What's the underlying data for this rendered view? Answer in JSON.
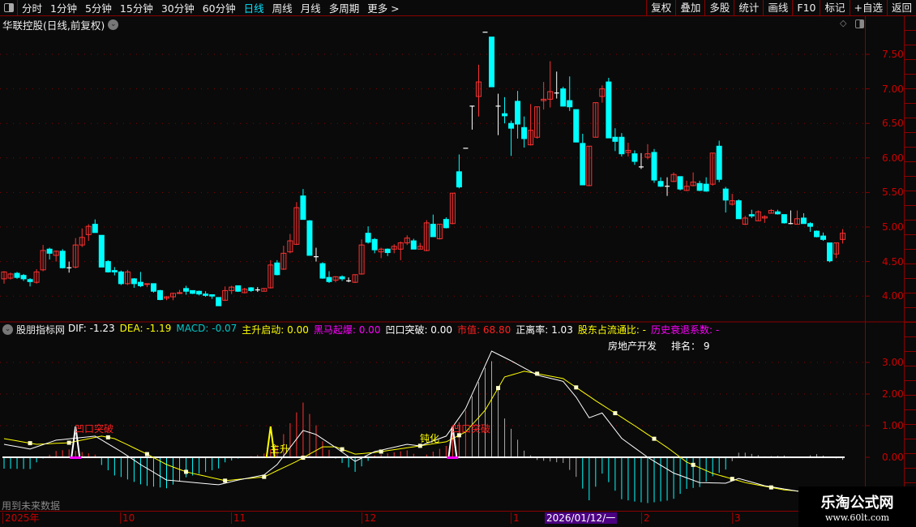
{
  "topbar": {
    "tabs": [
      "分时",
      "1分钟",
      "5分钟",
      "15分钟",
      "30分钟",
      "60分钟",
      "日线",
      "周线",
      "月线",
      "多周期",
      "更多 >"
    ],
    "active": "日线",
    "buttons": [
      "复权",
      "叠加",
      "多股",
      "统计",
      "画线",
      "F10",
      "标记",
      "+自选",
      "返回"
    ]
  },
  "title": "华联控股(日线,前复权)",
  "price_axis": [
    "7.50",
    "7.00",
    "6.50",
    "6.00",
    "5.50",
    "5.00",
    "4.50",
    "4.00"
  ],
  "ind_axis": [
    "3.00",
    "2.00",
    "1.00",
    "0.00"
  ],
  "indicator": {
    "name": "股朋指标网",
    "items": [
      {
        "label": "DIF: -1.23",
        "color": "#ffffff"
      },
      {
        "label": "DEA: -1.19",
        "color": "#ffff00"
      },
      {
        "label": "MACD: -0.07",
        "color": "#00c8c8"
      },
      {
        "label": "主升启动: 0.00",
        "color": "#ffff00"
      },
      {
        "label": "黑马起爆: 0.00",
        "color": "#ff00ff"
      },
      {
        "label": "凹口突破: 0.00",
        "color": "#ffffff"
      },
      {
        "label": "市值: 68.80",
        "color": "#ff2020"
      },
      {
        "label": "正离率: 1.03",
        "color": "#ffffff"
      },
      {
        "label": "股东占流通比: -",
        "color": "#ffff00"
      },
      {
        "label": "历史衰退系数: -",
        "color": "#ff00ff"
      }
    ],
    "sector": "房地产开发",
    "rank": "排名： 9"
  },
  "signals": {
    "breakout": "凹口突破",
    "main_rise": "主升",
    "dull": "钝化"
  },
  "future_note": "用到未来数据",
  "date_axis": {
    "labels": [
      "2025年",
      "10",
      "11",
      "12",
      "1",
      "2",
      "3"
    ],
    "current": "2026/01/12/一"
  },
  "watermark": {
    "name": "乐淘公式网",
    "url": "www.60lt.com"
  },
  "colors": {
    "up": "#ff3232",
    "down": "#00ffff",
    "doji": "#ffffff",
    "grid": "#8b0000"
  },
  "chart_data": {
    "type": "candlestick",
    "ylim": [
      3.7,
      7.9
    ],
    "ohlc": [
      [
        4.25,
        4.36,
        4.18,
        4.35
      ],
      [
        4.26,
        4.34,
        4.24,
        4.32
      ],
      [
        4.33,
        4.35,
        4.25,
        4.27
      ],
      [
        4.3,
        4.32,
        4.22,
        4.25
      ],
      [
        4.24,
        4.26,
        4.14,
        4.21
      ],
      [
        4.2,
        4.39,
        4.18,
        4.35
      ],
      [
        4.38,
        4.74,
        4.36,
        4.66
      ],
      [
        4.68,
        4.7,
        4.53,
        4.62
      ],
      [
        4.59,
        4.66,
        4.5,
        4.65
      ],
      [
        4.65,
        4.68,
        4.4,
        4.41
      ],
      [
        4.41,
        4.5,
        4.34,
        4.41
      ],
      [
        4.42,
        4.84,
        4.4,
        4.74
      ],
      [
        4.74,
        4.98,
        4.71,
        4.85
      ],
      [
        4.89,
        5.04,
        4.8,
        5.01
      ],
      [
        5.04,
        5.11,
        4.92,
        4.92
      ],
      [
        4.88,
        4.88,
        4.42,
        4.42
      ],
      [
        4.5,
        4.52,
        4.34,
        4.35
      ],
      [
        4.37,
        4.42,
        4.3,
        4.35
      ],
      [
        4.35,
        4.37,
        4.16,
        4.18
      ],
      [
        4.18,
        4.38,
        4.16,
        4.35
      ],
      [
        4.25,
        4.26,
        4.12,
        4.18
      ],
      [
        4.2,
        4.35,
        4.13,
        4.15
      ],
      [
        4.17,
        4.18,
        4.13,
        4.18
      ],
      [
        4.18,
        4.18,
        4.05,
        4.07
      ],
      [
        4.08,
        4.09,
        3.94,
        3.95
      ],
      [
        3.97,
        4.0,
        3.94,
        3.99
      ],
      [
        3.99,
        4.05,
        3.94,
        4.04
      ],
      [
        4.04,
        4.09,
        4.03,
        4.05
      ],
      [
        4.11,
        4.15,
        4.02,
        4.07
      ],
      [
        4.08,
        4.08,
        4.03,
        4.04
      ],
      [
        4.07,
        4.08,
        4.01,
        4.03
      ],
      [
        4.03,
        4.07,
        3.99,
        4.01
      ],
      [
        4.02,
        4.02,
        3.96,
        4.0
      ],
      [
        3.98,
        3.98,
        3.86,
        3.86
      ],
      [
        3.94,
        4.14,
        3.93,
        4.08
      ],
      [
        4.08,
        4.15,
        4.03,
        4.13
      ],
      [
        4.15,
        4.15,
        4.06,
        4.07
      ],
      [
        4.05,
        4.12,
        4.04,
        4.1
      ],
      [
        4.12,
        4.13,
        4.06,
        4.08
      ],
      [
        4.09,
        4.13,
        4.06,
        4.09
      ],
      [
        4.07,
        4.11,
        4.07,
        4.11
      ],
      [
        4.12,
        4.52,
        4.11,
        4.45
      ],
      [
        4.48,
        4.52,
        4.3,
        4.31
      ],
      [
        4.39,
        4.73,
        4.38,
        4.62
      ],
      [
        4.64,
        4.9,
        4.62,
        4.8
      ],
      [
        4.75,
        5.36,
        4.74,
        5.28
      ],
      [
        5.45,
        5.55,
        5.11,
        5.11
      ],
      [
        5.09,
        5.1,
        4.59,
        4.59
      ],
      [
        4.57,
        4.7,
        4.5,
        4.57
      ],
      [
        4.47,
        4.49,
        4.25,
        4.26
      ],
      [
        4.27,
        4.36,
        4.19,
        4.21
      ],
      [
        4.23,
        4.29,
        4.2,
        4.28
      ],
      [
        4.28,
        4.3,
        4.22,
        4.25
      ],
      [
        4.22,
        4.27,
        4.2,
        4.22
      ],
      [
        4.2,
        4.31,
        4.19,
        4.31
      ],
      [
        4.32,
        4.82,
        4.31,
        4.74
      ],
      [
        4.91,
        5.01,
        4.76,
        4.78
      ],
      [
        4.82,
        4.84,
        4.62,
        4.67
      ],
      [
        4.64,
        4.7,
        4.55,
        4.68
      ],
      [
        4.68,
        4.69,
        4.58,
        4.63
      ],
      [
        4.68,
        4.75,
        4.62,
        4.72
      ],
      [
        4.68,
        4.79,
        4.52,
        4.77
      ],
      [
        4.77,
        4.88,
        4.74,
        4.84
      ],
      [
        4.8,
        4.83,
        4.68,
        4.68
      ],
      [
        4.68,
        4.77,
        4.68,
        4.72
      ],
      [
        4.66,
        5.1,
        4.65,
        5.06
      ],
      [
        5.04,
        5.18,
        4.86,
        4.86
      ],
      [
        4.83,
        5.04,
        4.82,
        5.04
      ],
      [
        5.11,
        5.14,
        4.98,
        4.99
      ],
      [
        5.05,
        5.49,
        5.04,
        5.49
      ],
      [
        5.8,
        6.05,
        5.56,
        5.58
      ],
      [
        6.14,
        6.14,
        6.14,
        6.14
      ],
      [
        6.75,
        6.75,
        6.41,
        6.75
      ],
      [
        6.89,
        7.35,
        6.6,
        7.1
      ],
      [
        7.82,
        7.82,
        7.82,
        7.82
      ],
      [
        7.75,
        7.75,
        7.03,
        7.03
      ],
      [
        6.75,
        6.93,
        6.33,
        6.75
      ],
      [
        6.64,
        6.88,
        6.5,
        6.61
      ],
      [
        6.5,
        6.54,
        6.03,
        6.43
      ],
      [
        6.82,
        6.97,
        6.28,
        6.49
      ],
      [
        6.44,
        6.6,
        6.15,
        6.28
      ],
      [
        6.19,
        6.78,
        6.18,
        6.4
      ],
      [
        6.3,
        6.74,
        6.28,
        6.74
      ],
      [
        6.83,
        7.1,
        6.7,
        6.85
      ],
      [
        6.85,
        7.4,
        6.73,
        6.96
      ],
      [
        6.94,
        7.25,
        6.86,
        6.94
      ],
      [
        7.0,
        7.03,
        6.76,
        6.75
      ],
      [
        6.83,
        7.18,
        6.68,
        6.74
      ],
      [
        6.7,
        6.7,
        6.23,
        6.23
      ],
      [
        6.21,
        6.35,
        5.61,
        5.61
      ],
      [
        5.6,
        6.17,
        5.59,
        6.17
      ],
      [
        6.3,
        6.8,
        6.3,
        6.8
      ],
      [
        6.89,
        7.05,
        6.8,
        7.0
      ],
      [
        7.1,
        7.16,
        6.29,
        6.29
      ],
      [
        6.3,
        6.43,
        6.1,
        6.24
      ],
      [
        6.3,
        6.36,
        6.02,
        6.06
      ],
      [
        6.08,
        6.22,
        6.02,
        6.11
      ],
      [
        6.06,
        6.11,
        5.9,
        5.95
      ],
      [
        5.87,
        6.07,
        5.84,
        5.87
      ],
      [
        6.01,
        6.2,
        5.98,
        6.06
      ],
      [
        6.08,
        6.13,
        5.64,
        5.68
      ],
      [
        5.66,
        5.72,
        5.58,
        5.59
      ],
      [
        5.59,
        5.72,
        5.45,
        5.59
      ],
      [
        5.66,
        5.79,
        5.65,
        5.76
      ],
      [
        5.73,
        5.73,
        5.53,
        5.55
      ],
      [
        5.53,
        5.67,
        5.52,
        5.59
      ],
      [
        5.6,
        5.79,
        5.59,
        5.65
      ],
      [
        5.63,
        5.67,
        5.52,
        5.53
      ],
      [
        5.62,
        5.72,
        5.51,
        5.52
      ],
      [
        5.62,
        6.07,
        5.6,
        6.07
      ],
      [
        6.17,
        6.25,
        5.65,
        5.69
      ],
      [
        5.55,
        5.58,
        5.21,
        5.39
      ],
      [
        5.33,
        5.48,
        5.31,
        5.38
      ],
      [
        5.38,
        5.4,
        5.12,
        5.12
      ],
      [
        5.04,
        5.16,
        5.03,
        5.13
      ],
      [
        5.18,
        5.25,
        5.13,
        5.16
      ],
      [
        5.09,
        5.24,
        5.09,
        5.22
      ],
      [
        5.13,
        5.17,
        5.06,
        5.15
      ],
      [
        5.2,
        5.26,
        5.2,
        5.24
      ],
      [
        5.22,
        5.25,
        5.18,
        5.19
      ],
      [
        5.18,
        5.18,
        5.05,
        5.06
      ],
      [
        5.05,
        5.24,
        5.04,
        5.05
      ],
      [
        5.04,
        5.24,
        5.04,
        5.12
      ],
      [
        5.13,
        5.2,
        5.05,
        5.05
      ],
      [
        5.05,
        5.07,
        4.93,
        5.01
      ],
      [
        4.94,
        4.95,
        4.85,
        4.86
      ],
      [
        4.87,
        4.92,
        4.8,
        4.82
      ],
      [
        4.77,
        4.77,
        4.49,
        4.51
      ],
      [
        4.61,
        4.77,
        4.55,
        4.77
      ],
      [
        4.82,
        4.97,
        4.76,
        4.91
      ]
    ],
    "macd": {
      "ylim": [
        -1.4,
        3.6
      ],
      "dif": [
        [
          0,
          0.41
        ],
        [
          4,
          0.26
        ],
        [
          8,
          0.54
        ],
        [
          14,
          0.67
        ],
        [
          18,
          0.18
        ],
        [
          21,
          -0.23
        ],
        [
          25,
          -0.72
        ],
        [
          33,
          -0.87
        ],
        [
          36,
          -0.72
        ],
        [
          40,
          -0.56
        ],
        [
          42,
          -0.23
        ],
        [
          46,
          0.85
        ],
        [
          48,
          0.72
        ],
        [
          51,
          0.31
        ],
        [
          54,
          -0.13
        ],
        [
          57,
          0.18
        ],
        [
          62,
          0.41
        ],
        [
          64,
          0.36
        ],
        [
          68,
          0.67
        ],
        [
          71,
          1.54
        ],
        [
          75,
          3.36
        ],
        [
          78,
          3.05
        ],
        [
          82,
          2.6
        ],
        [
          86,
          2.4
        ],
        [
          88,
          1.9
        ],
        [
          90,
          1.25
        ],
        [
          92,
          1.4
        ],
        [
          95,
          0.6
        ],
        [
          99,
          0.0
        ],
        [
          103,
          -0.5
        ],
        [
          107,
          -0.8
        ],
        [
          111,
          -0.82
        ],
        [
          113,
          -0.67
        ],
        [
          117,
          -0.9
        ],
        [
          122,
          -1.07
        ],
        [
          125,
          -1.07
        ],
        [
          129,
          -1.23
        ]
      ],
      "dea": [
        [
          0,
          0.59
        ],
        [
          5,
          0.41
        ],
        [
          10,
          0.46
        ],
        [
          15,
          0.67
        ],
        [
          17,
          0.59
        ],
        [
          22,
          0.1
        ],
        [
          25,
          -0.23
        ],
        [
          28,
          -0.46
        ],
        [
          34,
          -0.74
        ],
        [
          40,
          -0.62
        ],
        [
          45,
          -0.13
        ],
        [
          49,
          0.33
        ],
        [
          51,
          0.33
        ],
        [
          54,
          0.1
        ],
        [
          57,
          0.15
        ],
        [
          63,
          0.33
        ],
        [
          68,
          0.49
        ],
        [
          71,
          0.8
        ],
        [
          74,
          1.49
        ],
        [
          77,
          2.54
        ],
        [
          80,
          2.72
        ],
        [
          86,
          2.49
        ],
        [
          91,
          1.79
        ],
        [
          97,
          1.0
        ],
        [
          102,
          0.31
        ],
        [
          105,
          -0.15
        ],
        [
          109,
          -0.51
        ],
        [
          114,
          -0.8
        ],
        [
          120,
          -1.03
        ],
        [
          129,
          -1.19
        ]
      ]
    }
  }
}
